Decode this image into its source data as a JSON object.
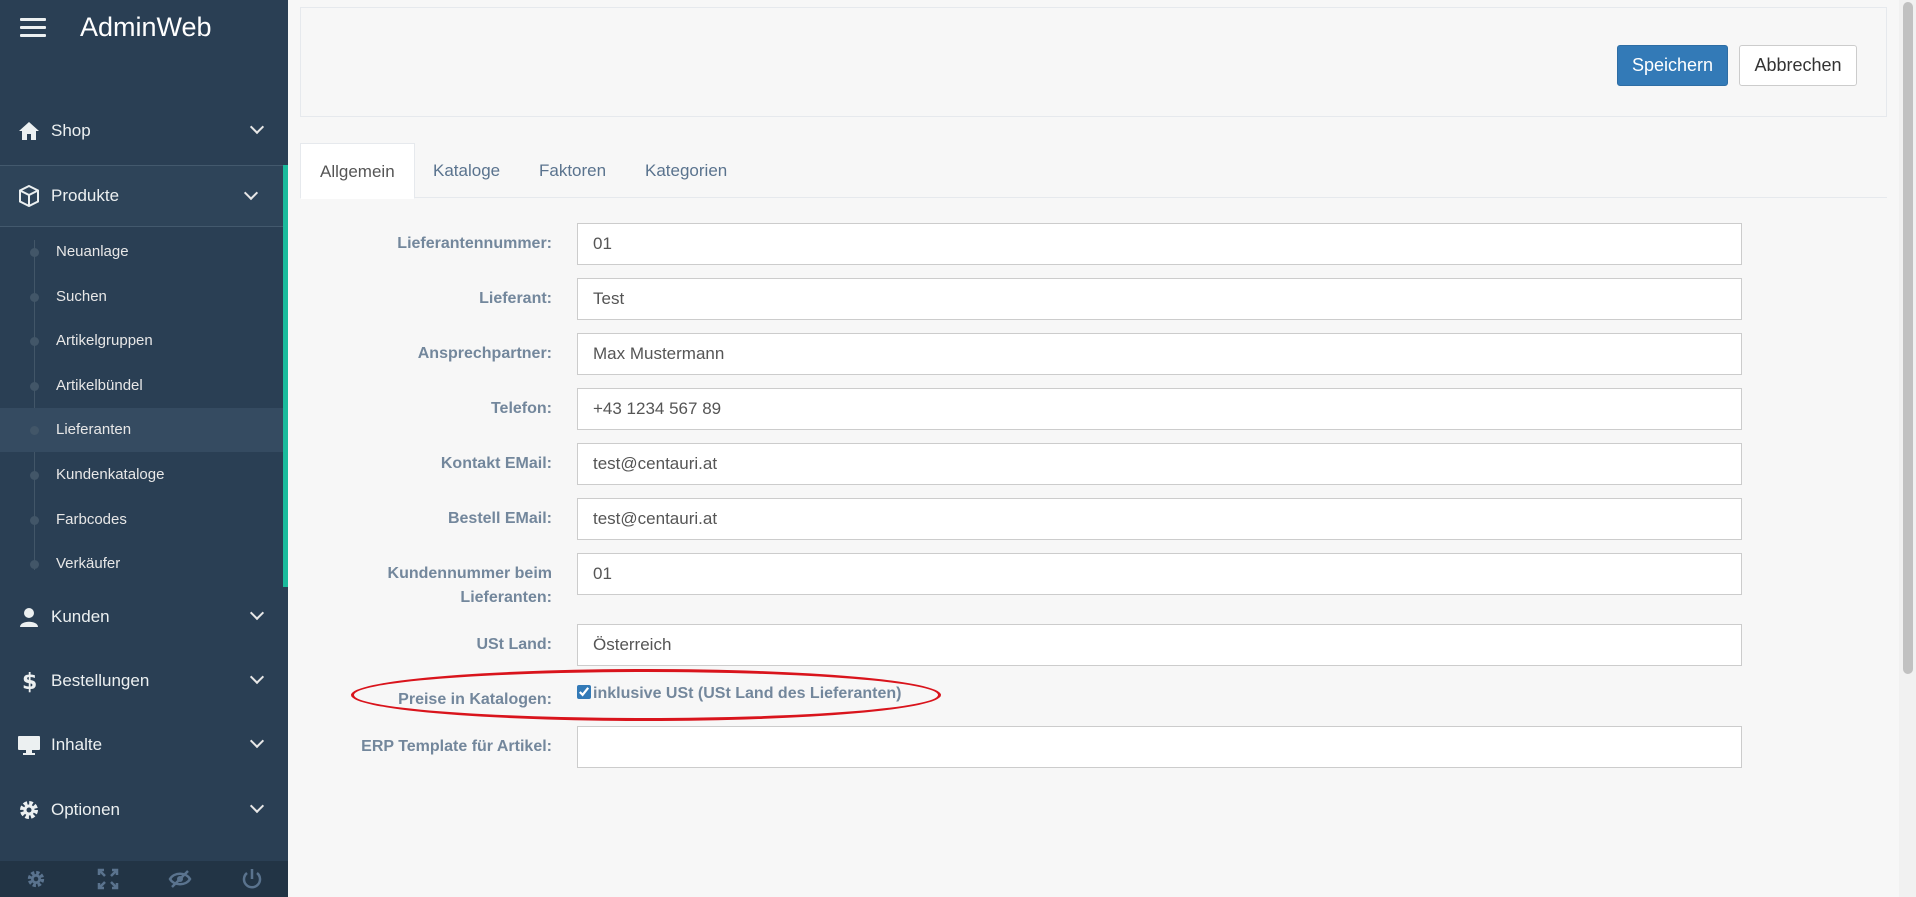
{
  "app": {
    "title": "AdminWeb"
  },
  "sidebar": {
    "menu": [
      {
        "label": "Shop",
        "icon": "home-icon"
      },
      {
        "label": "Produkte",
        "icon": "cube-icon"
      },
      {
        "label": "Kunden",
        "icon": "user-icon"
      },
      {
        "label": "Bestellungen",
        "icon": "dollar-icon"
      },
      {
        "label": "Inhalte",
        "icon": "monitor-icon"
      },
      {
        "label": "Optionen",
        "icon": "gear-icon"
      }
    ],
    "submenu": [
      {
        "label": "Neuanlage"
      },
      {
        "label": "Suchen"
      },
      {
        "label": "Artikelgruppen"
      },
      {
        "label": "Artikelbündel"
      },
      {
        "label": "Lieferanten"
      },
      {
        "label": "Kundenkataloge"
      },
      {
        "label": "Farbcodes"
      },
      {
        "label": "Verkäufer"
      }
    ],
    "footer_icons": [
      "settings-icon",
      "fullscreen-icon",
      "hide-icon",
      "power-icon"
    ]
  },
  "toolbar": {
    "save_label": "Speichern",
    "cancel_label": "Abbrechen"
  },
  "tabs": [
    {
      "label": "Allgemein"
    },
    {
      "label": "Kataloge"
    },
    {
      "label": "Faktoren"
    },
    {
      "label": "Kategorien"
    }
  ],
  "form": {
    "lieferantennummer": {
      "label": "Lieferantennummer:",
      "value": "01"
    },
    "lieferant": {
      "label": "Lieferant:",
      "value": "Test"
    },
    "ansprechpartner": {
      "label": "Ansprechpartner:",
      "value": "Max Mustermann"
    },
    "telefon": {
      "label": "Telefon:",
      "value": "+43 1234 567 89"
    },
    "kontakt_email": {
      "label": "Kontakt EMail:",
      "value": "test@centauri.at"
    },
    "bestell_email": {
      "label": "Bestell EMail:",
      "value": "test@centauri.at"
    },
    "kundennummer": {
      "label_line1": "Kundennummer beim",
      "label_line2": "Lieferanten:",
      "value": "01"
    },
    "ust_land": {
      "label": "USt Land:",
      "value": "Österreich"
    },
    "preise": {
      "label": "Preise in Katalogen:",
      "checkbox_label": "inklusive USt (USt Land des Lieferanten)",
      "checked": true
    },
    "erp_template": {
      "label": "ERP Template für Artikel:",
      "value": ""
    }
  },
  "colors": {
    "sidebar_bg": "#2a3f54",
    "accent": "#1abb9c",
    "primary": "#337ab7",
    "annotation": "#d9141c"
  }
}
